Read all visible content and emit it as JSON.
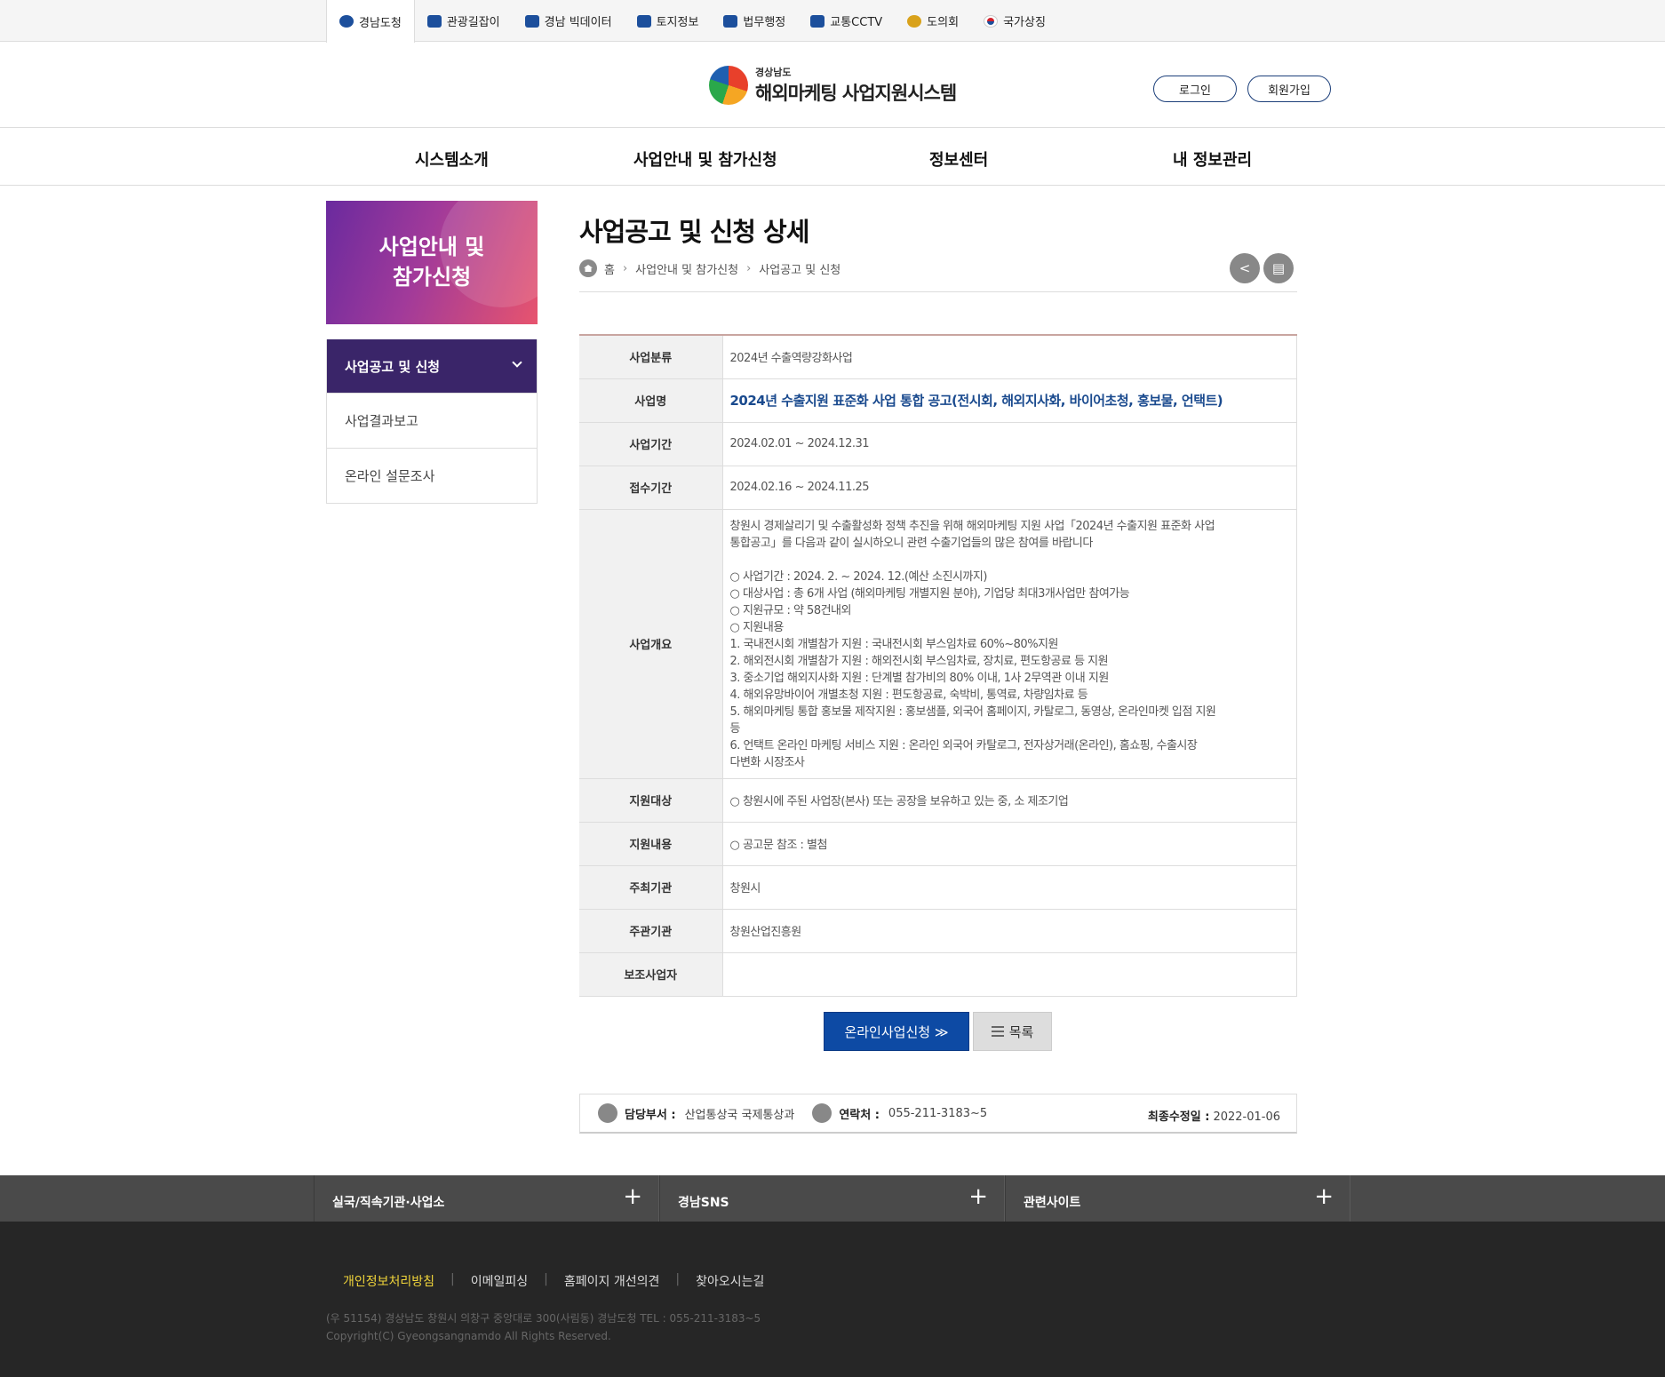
{
  "topbar": {
    "items": [
      {
        "label": "경남도청",
        "icon": "gyeongnam-logo-icon"
      },
      {
        "label": "관광길잡이",
        "icon": "camera-icon"
      },
      {
        "label": "경남 빅데이터",
        "icon": "bar-chart-icon"
      },
      {
        "label": "토지정보",
        "icon": "map-icon"
      },
      {
        "label": "법무행정",
        "icon": "gavel-icon"
      },
      {
        "label": "교통CCTV",
        "icon": "car-icon"
      },
      {
        "label": "도의회",
        "icon": "council-icon"
      },
      {
        "label": "국가상징",
        "icon": "taegeuk-flag-icon"
      }
    ]
  },
  "header": {
    "logo_sub": "경상남도",
    "logo_main": "해외마케팅 사업지원시스템",
    "login": "로그인",
    "signup": "회원가입"
  },
  "gnb": [
    "시스템소개",
    "사업안내 및 참가신청",
    "정보센터",
    "내 정보관리"
  ],
  "sidebar": {
    "title_line1": "사업안내 및",
    "title_line2": "참가신청",
    "items": [
      "사업공고 및 신청",
      "사업결과보고",
      "온라인 설문조사"
    ]
  },
  "page": {
    "title": "사업공고 및 신청 상세",
    "breadcrumb": [
      "홈",
      "사업안내 및 참가신청",
      "사업공고 및 신청"
    ]
  },
  "info": {
    "category": {
      "label": "사업분류",
      "value": "2024년 수출역량강화사업"
    },
    "name": {
      "label": "사업명",
      "value": "2024년 수출지원 표준화 사업 통합 공고(전시회, 해외지사화, 바이어초청, 홍보물, 언택트)"
    },
    "period": {
      "label": "사업기간",
      "value": "2024.02.01 ~ 2024.12.31"
    },
    "reception": {
      "label": "접수기간",
      "value": "2024.02.16 ~ 2024.11.25"
    },
    "overview": {
      "label": "사업개요",
      "lines": [
        "창원시 경제살리기 및 수출활성화 정책 추진을 위해 해외마케팅 지원 사업「2024년 수출지원 표준화 사업",
        "통합공고」를 다음과 같이 실시하오니 관련 수출기업들의 많은 참여를 바랍니다",
        "",
        "○ 사업기간 : 2024. 2. ~ 2024. 12.(예산 소진시까지)",
        "○ 대상사업 : 총 6개 사업 (해외마케팅 개별지원 분야), 기업당 최대3개사업만 참여가능",
        "○ 지원규모 : 약 58건내외",
        "○ 지원내용",
        "1. 국내전시회 개별참가 지원 : 국내전시회 부스임차료 60%~80%지원",
        "2. 해외전시회 개별참가 지원 : 해외전시회 부스임차료, 장치료, 편도항공료 등 지원",
        "3. 중소기업 해외지사화 지원 : 단계별 참가비의 80% 이내, 1사 2무역관 이내 지원",
        "4. 해외유망바이어 개별초청 지원 : 편도항공료, 숙박비, 통역료, 차량임차료 등",
        "5. 해외마케팅 통합 홍보물 제작지원 : 홍보샘플, 외국어 홈페이지, 카탈로그, 동영상, 온라인마켓 입점 지원",
        "등",
        "6. 언택트 온라인 마케팅 서비스 지원 : 온라인 외국어 카탈로그, 전자상거래(온라인), 홈쇼핑, 수출시장",
        "다변화 시장조사"
      ]
    },
    "target": {
      "label": "지원대상",
      "value": "○ 창원시에 주된 사업장(본사) 또는 공장을 보유하고 있는 중, 소 제조기업"
    },
    "content": {
      "label": "지원내용",
      "value": "○ 공고문 참조 : 별첨"
    },
    "host": {
      "label": "주최기관",
      "value": "창원시"
    },
    "organizer": {
      "label": "주관기관",
      "value": "창원산업진흥원"
    },
    "sub": {
      "label": "보조사업자",
      "value": ""
    }
  },
  "buttons": {
    "apply": "온라인사업신청 ≫",
    "list": "목록"
  },
  "manager": {
    "dept_label": "담당부서 :",
    "dept": "산업통상국 국제통상과",
    "contact_label": "연락처 :",
    "contact": "055-211-3183~5",
    "updated_label": "최종수정일 :",
    "updated": "2022-01-06"
  },
  "footer": {
    "bar": [
      "실국/직속기관·사업소",
      "경남SNS",
      "관련사이트"
    ],
    "links": [
      "개인정보처리방침",
      "이메일피싱",
      "홈페이지 개선의견",
      "찾아오시는길"
    ],
    "address": "(우 51154) 경상남도 창원시 의창구 중앙대로 300(사림동) 경남도청 TEL : 055-211-3183~5",
    "copyright": "Copyright(C) Gyeongsangnamdo All Rights Reserved."
  }
}
